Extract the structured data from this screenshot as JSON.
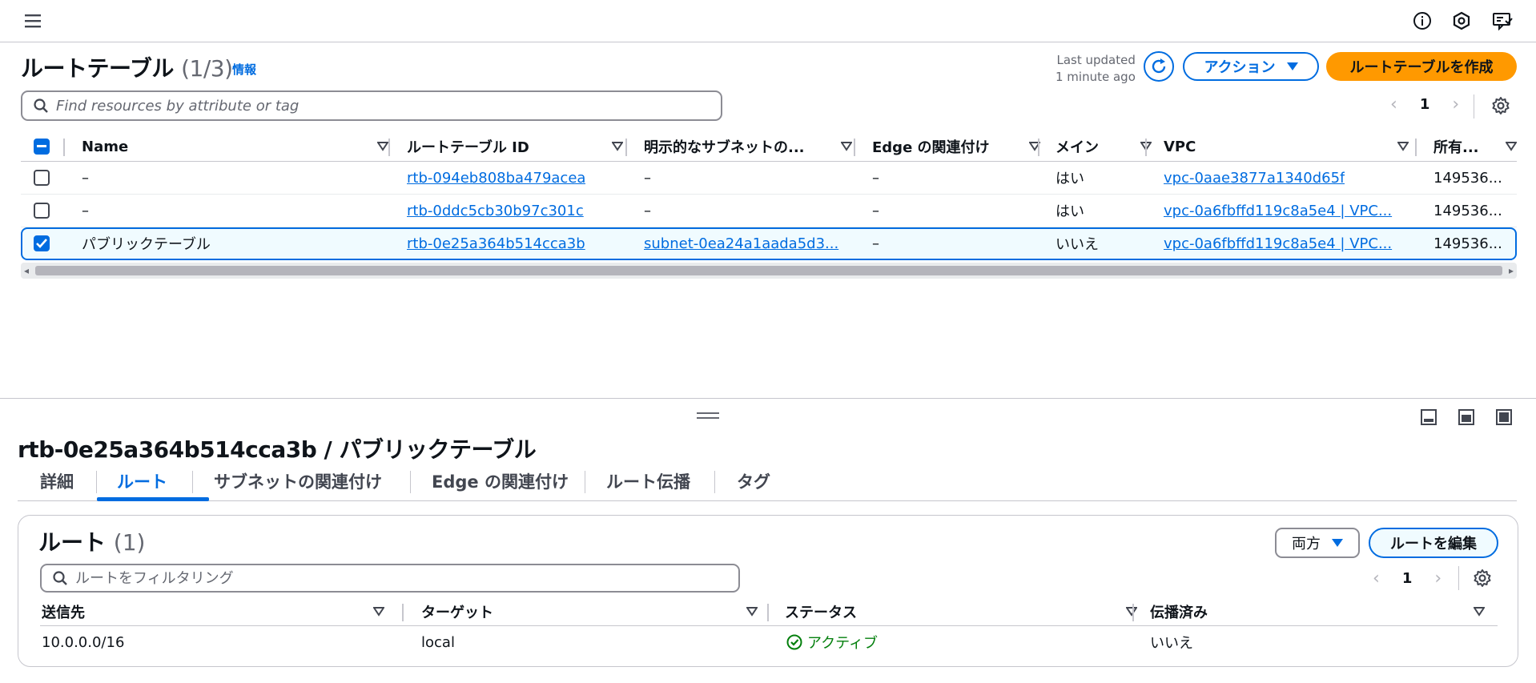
{
  "topbar": {
    "menu_icon": "menu-icon",
    "info_icon": "info-icon",
    "notifications_icon": "notifications-icon",
    "feedback_icon": "feedback-icon"
  },
  "header": {
    "title": "ルートテーブル",
    "count": "(1/3)",
    "info_link": "情報",
    "last_updated_line1": "Last updated",
    "last_updated_line2": "1 minute ago",
    "actions_label": "アクション",
    "create_label": "ルートテーブルを作成"
  },
  "search": {
    "placeholder": "Find resources by attribute or tag"
  },
  "pagination": {
    "page": "1"
  },
  "table": {
    "columns": [
      "Name",
      "ルートテーブル ID",
      "明示的なサブネットの...",
      "Edge の関連付け",
      "メイン",
      "VPC",
      "所有..."
    ],
    "rows": [
      {
        "checked": false,
        "name": "–",
        "id": "rtb-094eb808ba479acea",
        "subnet": "–",
        "edge": "–",
        "main": "はい",
        "vpc": "vpc-0aae3877a1340d65f",
        "owner": "149536..."
      },
      {
        "checked": false,
        "name": "–",
        "id": "rtb-0ddc5cb30b97c301c",
        "subnet": "–",
        "edge": "–",
        "main": "はい",
        "vpc": "vpc-0a6fbffd119c8a5e4 | VPC...",
        "owner": "149536..."
      },
      {
        "checked": true,
        "name": "パブリックテーブル",
        "id": "rtb-0e25a364b514cca3b",
        "subnet": "subnet-0ea24a1aada5d3...",
        "edge": "–",
        "main": "いいえ",
        "vpc": "vpc-0a6fbffd119c8a5e4 | VPC...",
        "owner": "149536..."
      }
    ]
  },
  "detail": {
    "title": "rtb-0e25a364b514cca3b / パブリックテーブル",
    "tabs": [
      "詳細",
      "ルート",
      "サブネットの関連付け",
      "Edge の関連付け",
      "ルート伝播",
      "タグ"
    ],
    "active_tab": "ルート",
    "routes": {
      "title": "ルート",
      "count": "(1)",
      "filter_select": "両方",
      "edit_label": "ルートを編集",
      "search_placeholder": "ルートをフィルタリング",
      "page": "1",
      "columns": [
        "送信先",
        "ターゲット",
        "ステータス",
        "伝播済み"
      ],
      "rows": [
        {
          "destination": "10.0.0.0/16",
          "target": "local",
          "status": "アクティブ",
          "propagated": "いいえ"
        }
      ]
    }
  },
  "colors": {
    "accent": "#006ce0",
    "primary_button": "#ff9900",
    "success": "#037f0c"
  }
}
